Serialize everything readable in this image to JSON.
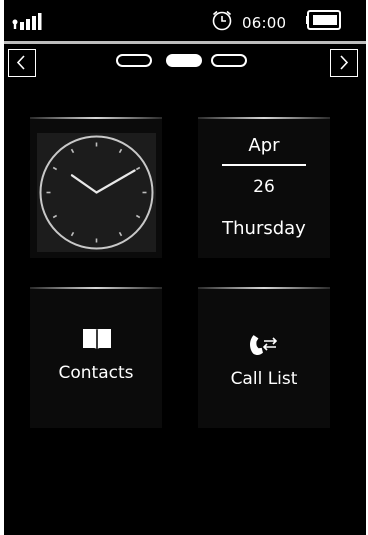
{
  "status": {
    "time": "06:00",
    "signal_icon": "signal-strength-icon",
    "alarm_icon": "alarm-clock-icon",
    "battery_icon": "battery-full-icon"
  },
  "navigation": {
    "prev_icon": "chevron-left-icon",
    "next_icon": "chevron-right-icon",
    "page_count": 3,
    "current_page": 2
  },
  "tiles": {
    "clock": {
      "icon": "analog-clock-icon",
      "hour": 10,
      "minute": 10
    },
    "date": {
      "month": "Apr",
      "day": "26",
      "weekday": "Thursday"
    },
    "contacts": {
      "label": "Contacts",
      "icon": "book-icon"
    },
    "calls": {
      "label": "Call List",
      "icon": "phone-arrows-icon"
    }
  },
  "colors": {
    "background": "#000000",
    "foreground": "#ffffff",
    "divider": "#bdbdbd"
  }
}
